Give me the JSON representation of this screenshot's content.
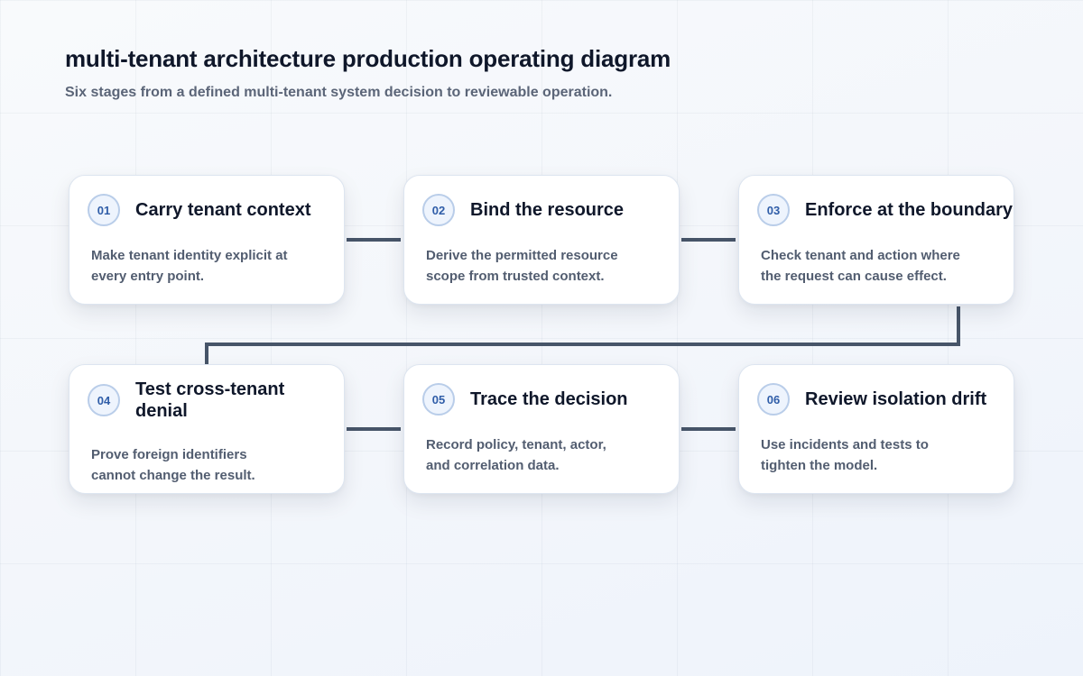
{
  "diagram": {
    "title": "multi-tenant architecture production operating diagram",
    "subtitle": "Six stages from a defined multi-tenant system decision to reviewable operation.",
    "connector_color": "#475569",
    "stages": [
      {
        "number": "01",
        "title": "Carry tenant context",
        "description": "Make tenant identity explicit at every entry point."
      },
      {
        "number": "02",
        "title": "Bind the resource",
        "description": "Derive the permitted resource scope from trusted context."
      },
      {
        "number": "03",
        "title": "Enforce at the boundary",
        "description": "Check tenant and action where the request can cause effect."
      },
      {
        "number": "04",
        "title": "Test cross-tenant denial",
        "description": "Prove foreign identifiers cannot change the result."
      },
      {
        "number": "05",
        "title": "Trace the decision",
        "description": "Record policy, tenant, actor, and correlation data."
      },
      {
        "number": "06",
        "title": "Review isolation drift",
        "description": "Use incidents and tests to tighten the model."
      }
    ]
  }
}
